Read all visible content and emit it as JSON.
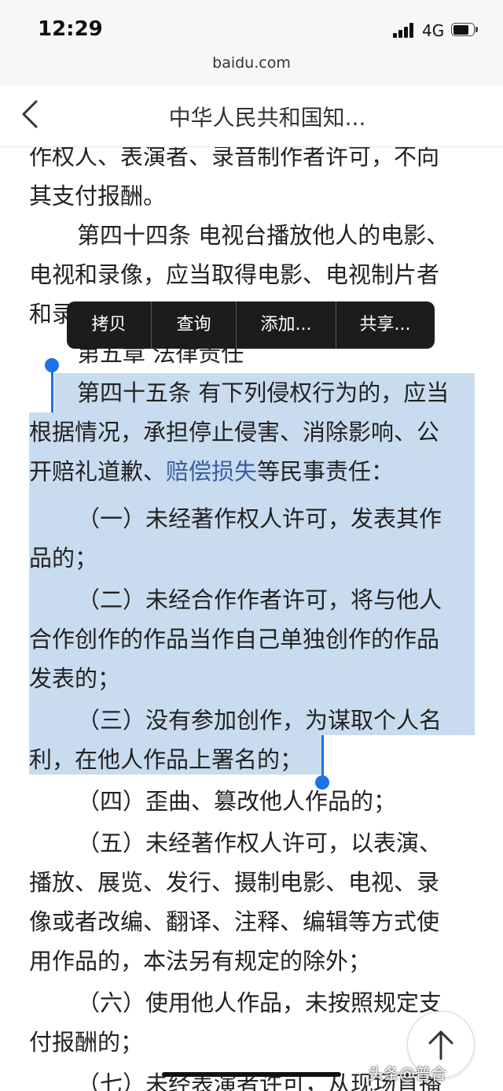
{
  "status_bar": {
    "time": "12:29",
    "network": "4G",
    "url": "baidu.com"
  },
  "nav": {
    "title": "中华人民共和国知..."
  },
  "context_menu": {
    "items": [
      "拷贝",
      "查询",
      "添加...",
      "共享..."
    ]
  },
  "article": {
    "lines": [
      "作权人、表演者、录音制作者许可，不向",
      "其支付报酬。",
      "第四十四条 电视台播放他人的电影、",
      "电视和录像，应当取得电影、电视制片者",
      "和录",
      "第五章 法律责任",
      "第四十五条 有下列侵权行为的，应当",
      "根据情况，承担停止侵害、消除影响、公",
      "开赔礼道歉、",
      "赔偿损失",
      "等民事责任：",
      "（一）未经著作权人许可，发表其作",
      "品的；",
      "（二）未经合作作者许可，将与他人",
      "合作创作的作品当作自己单独创作的作品",
      "发表的；",
      "（三）没有参加创作，为谋取个人名",
      "利，在他人作品上署名的；",
      "（四）歪曲、篡改他人作品的；",
      "（五）未经著作权人许可，以表演、",
      "播放、展览、发行、摄制电影、电视、录",
      "像或者改编、翻译、注释、编辑等方式使",
      "用作品的，本法另有规定的除外；",
      "（六）使用他人作品，未按照规定支",
      "付报酬的；",
      "（七）未经表演者许可，从现场直播"
    ]
  },
  "watermark": "头条@普合"
}
